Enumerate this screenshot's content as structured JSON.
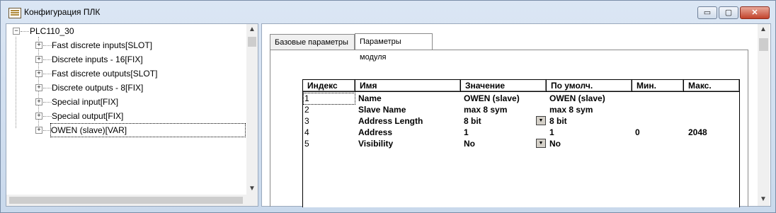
{
  "window": {
    "title": "Конфигурация ПЛК",
    "minimize": "▭",
    "maximize": "▢",
    "close": "✕"
  },
  "tree": {
    "root": "PLC110_30",
    "items": [
      "Fast discrete inputs[SLOT]",
      "Discrete inputs - 16[FIX]",
      "Fast discrete outputs[SLOT]",
      "Discrete outputs - 8[FIX]",
      "Special input[FIX]",
      "Special output[FIX]",
      "OWEN (slave)[VAR]"
    ],
    "expand_glyph": "+",
    "collapse_glyph": "−"
  },
  "tabs": [
    "Базовые параметры",
    "Параметры модуля"
  ],
  "active_tab": 1,
  "table": {
    "columns": [
      "Индекс",
      "Имя",
      "Значение",
      "По умолч.",
      "Мин.",
      "Макс."
    ],
    "rows": [
      {
        "index": "1",
        "name": "Name",
        "value": "OWEN (slave)",
        "default": "OWEN (slave)",
        "min": "",
        "max": ""
      },
      {
        "index": "2",
        "name": "Slave Name",
        "value": "max 8 sym",
        "default": "max 8 sym",
        "min": "",
        "max": ""
      },
      {
        "index": "3",
        "name": "Address Length",
        "value": "8 bit",
        "default": "8 bit",
        "min": "",
        "max": ""
      },
      {
        "index": "4",
        "name": "Address",
        "value": "1",
        "default": "1",
        "min": "0",
        "max": "2048"
      },
      {
        "index": "5",
        "name": "Visibility",
        "value": "No",
        "default": "No",
        "min": "",
        "max": ""
      }
    ]
  },
  "icons": {
    "scroll_up": "▲",
    "scroll_down": "▼",
    "dropdown": "▼"
  }
}
